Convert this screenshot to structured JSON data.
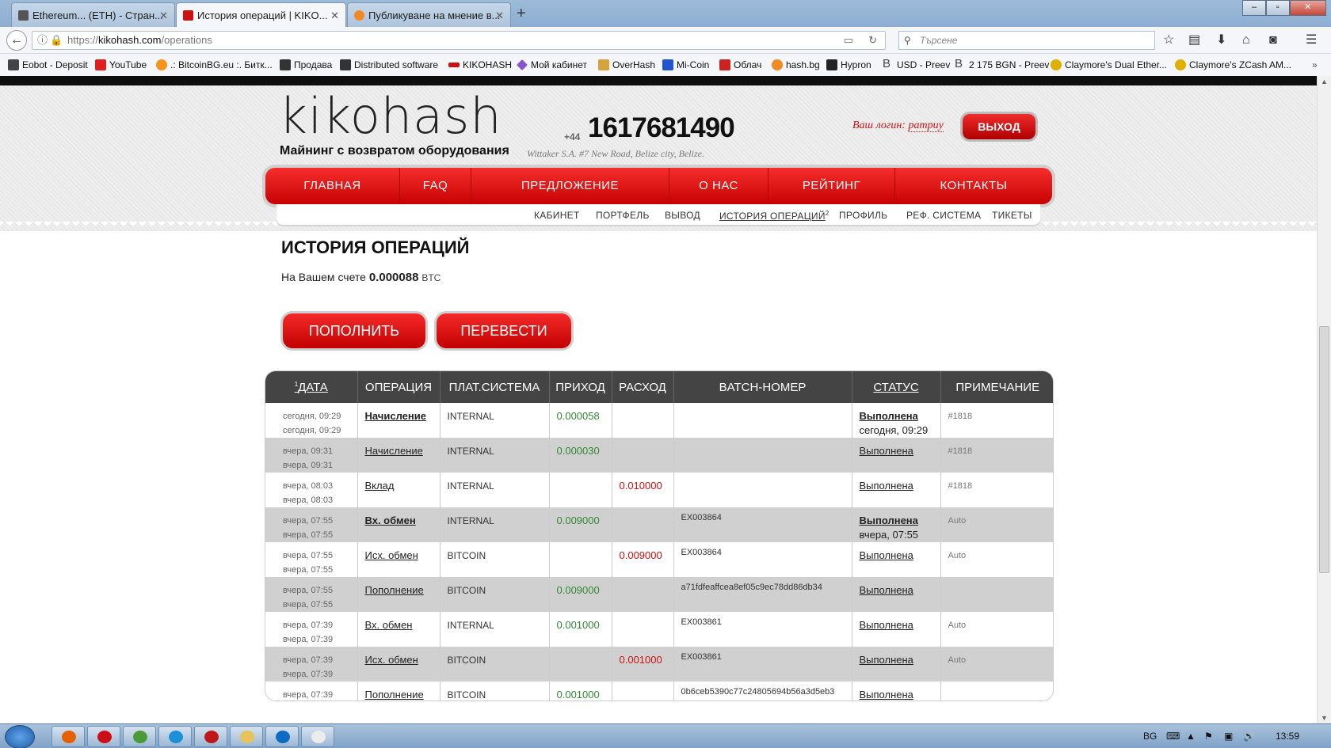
{
  "browser": {
    "tabs": [
      {
        "label": "Ethereum... (ETH) - Стран...",
        "favicon_color": "#555555"
      },
      {
        "label": "История операций | KIKO...",
        "favicon_color": "#cc1111"
      },
      {
        "label": "Публикуване на мнение в...",
        "favicon_color": "#f08a24"
      }
    ],
    "url_prefix": "https://",
    "url_host": "kikohash.com",
    "url_path": "/operations",
    "search_placeholder": "Търсене",
    "bookmarks": [
      {
        "label": "Eobot - Deposit",
        "color": "#444444"
      },
      {
        "label": "YouTube",
        "color": "#e02020"
      },
      {
        "label": ".: BitcoinBG.eu :. Битк...",
        "color": "#f7931a"
      },
      {
        "label": "Продава",
        "color": "#333333"
      },
      {
        "label": "Distributed software",
        "color": "#333333"
      },
      {
        "label": "KIKOHASH",
        "color": "#cc1111"
      },
      {
        "label": "Мой кабинет",
        "color": "#8855cc"
      },
      {
        "label": "OverHash",
        "color": "#d8a23a"
      },
      {
        "label": "Mi-Coin",
        "color": "#2255cc"
      },
      {
        "label": "Облач",
        "color": "#cc2222"
      },
      {
        "label": "hash.bg",
        "color": "#f08a24"
      },
      {
        "label": "Hypron",
        "color": "#222222"
      },
      {
        "label": "USD - Preev",
        "color": "#444444"
      },
      {
        "label": "2 175 BGN - Preev",
        "color": "#444444"
      },
      {
        "label": "Claymore's Dual Ether...",
        "color": "#e0b000"
      },
      {
        "label": "Claymore's ZCash AM...",
        "color": "#e0b000"
      }
    ]
  },
  "site": {
    "logo": "kikohash",
    "slogan": "Майнинг с возвратом оборудования",
    "phone_prefix": "+44",
    "phone": "1617681490",
    "address": "Wittaker S.A. #7 New Road, Belize city, Belize.",
    "login_label": "Ваш логин:",
    "login_user": "pampuy",
    "exit_label": "ВЫХОД",
    "menu": [
      "ГЛАВНАЯ",
      "FAQ",
      "ПРЕДЛОЖЕНИЕ",
      "О НАС",
      "РЕЙТИНГ",
      "КОНТАКТЫ"
    ],
    "submenu": [
      "КАБИНЕТ",
      "ПОРТФЕЛЬ",
      "ВЫВОД",
      "ИСТОРИЯ ОПЕРАЦИЙ",
      "ПРОФИЛЬ",
      "РЕФ. СИСТЕМА",
      "ТИКЕТЫ"
    ],
    "submenu_badge": "2"
  },
  "page": {
    "title": "ИСТОРИЯ ОПЕРАЦИЙ",
    "balance_prefix": "На Вашем счете",
    "balance_value": "0.000088",
    "balance_unit": "BTC",
    "topup_label": "ПОПОЛНИТЬ",
    "transfer_label": "ПЕРЕВЕСТИ"
  },
  "table": {
    "sort_index": "1",
    "headers": [
      "ДАТА",
      "ОПЕРАЦИЯ",
      "ПЛАТ.СИСТЕМА",
      "ПРИХОД",
      "РАСХОД",
      "BATCH-НОМЕР",
      "СТАТУС",
      "ПРИМЕЧАНИЕ"
    ],
    "rows": [
      {
        "date1": "сегодня, 09:29",
        "date2": "сегодня, 09:29",
        "op": "Начисление",
        "op_bold": true,
        "system": "INTERNAL",
        "income": "0.000058",
        "expense": "",
        "batch": "",
        "status": "Выполнена",
        "status_bold": true,
        "status_time": "сегодня, 09:29",
        "note": "#1818"
      },
      {
        "date1": "вчера, 09:31",
        "date2": "вчера, 09:31",
        "op": "Начисление",
        "op_bold": false,
        "system": "INTERNAL",
        "income": "0.000030",
        "expense": "",
        "batch": "",
        "status": "Выполнена",
        "status_bold": false,
        "status_time": "",
        "note": "#1818"
      },
      {
        "date1": "вчера, 08:03",
        "date2": "вчера, 08:03",
        "op": "Вклад",
        "op_bold": false,
        "system": "INTERNAL",
        "income": "",
        "expense": "0.010000",
        "batch": "",
        "status": "Выполнена",
        "status_bold": false,
        "status_time": "",
        "note": "#1818"
      },
      {
        "date1": "вчера, 07:55",
        "date2": "вчера, 07:55",
        "op": "Вх. обмен",
        "op_bold": true,
        "system": "INTERNAL",
        "income": "0.009000",
        "expense": "",
        "batch": "EX003864",
        "status": "Выполнена",
        "status_bold": true,
        "status_time": "вчера, 07:55",
        "note": "Auto"
      },
      {
        "date1": "вчера, 07:55",
        "date2": "вчера, 07:55",
        "op": "Исх. обмен",
        "op_bold": false,
        "system": "BITCOIN",
        "income": "",
        "expense": "0.009000",
        "batch": "EX003864",
        "status": "Выполнена",
        "status_bold": false,
        "status_time": "",
        "note": "Auto"
      },
      {
        "date1": "вчера, 07:55",
        "date2": "вчера, 07:55",
        "op": "Пополнение",
        "op_bold": false,
        "system": "BITCOIN",
        "income": "0.009000",
        "expense": "",
        "batch": "a71fdfeaffcea8ef05c9ec78dd86db34",
        "status": "Выполнена",
        "status_bold": false,
        "status_time": "",
        "note": ""
      },
      {
        "date1": "вчера, 07:39",
        "date2": "вчера, 07:39",
        "op": "Вх. обмен",
        "op_bold": false,
        "system": "INTERNAL",
        "income": "0.001000",
        "expense": "",
        "batch": "EX003861",
        "status": "Выполнена",
        "status_bold": false,
        "status_time": "",
        "note": "Auto"
      },
      {
        "date1": "вчера, 07:39",
        "date2": "вчера, 07:39",
        "op": "Исх. обмен",
        "op_bold": false,
        "system": "BITCOIN",
        "income": "",
        "expense": "0.001000",
        "batch": "EX003861",
        "status": "Выполнена",
        "status_bold": false,
        "status_time": "",
        "note": "Auto"
      },
      {
        "date1": "вчера, 07:39",
        "date2": "вчера, 07:39",
        "op": "Пополнение",
        "op_bold": false,
        "system": "BITCOIN",
        "income": "0.001000",
        "expense": "",
        "batch": "0b6ceb5390c77c24805694b56a3d5eb3",
        "status": "Выполнена",
        "status_bold": false,
        "status_time": "",
        "note": ""
      }
    ]
  },
  "taskbar": {
    "apps": [
      {
        "name": "firefox",
        "color": "#e66000"
      },
      {
        "name": "opera",
        "color": "#cc0f16"
      },
      {
        "name": "chrome",
        "color": "#4a9a3a"
      },
      {
        "name": "internet-explorer",
        "color": "#1e90d8"
      },
      {
        "name": "kikohash-app",
        "color": "#c01818"
      },
      {
        "name": "explorer",
        "color": "#e8c25a"
      },
      {
        "name": "teamviewer",
        "color": "#0e6bc2"
      },
      {
        "name": "notepad",
        "color": "#ececec"
      }
    ],
    "lang": "BG",
    "clock": "13:59"
  }
}
